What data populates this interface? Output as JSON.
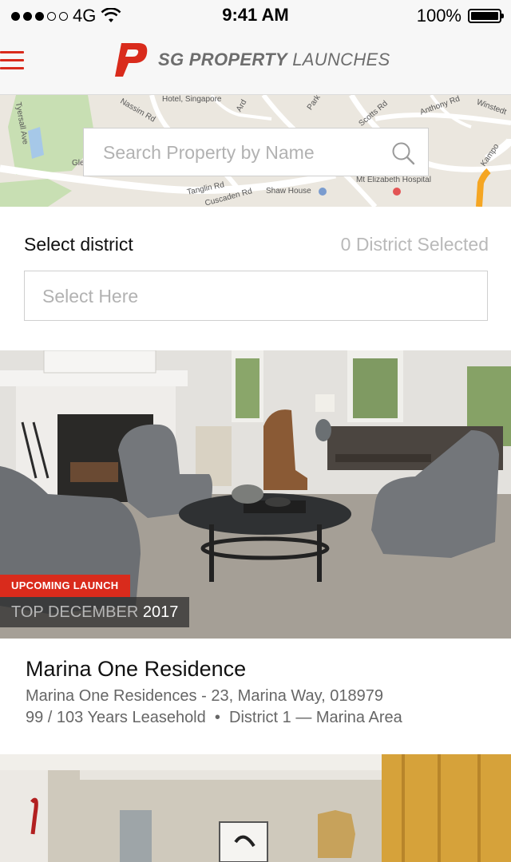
{
  "status_bar": {
    "carrier": "4G",
    "time": "9:41 AM",
    "battery": "100%"
  },
  "header": {
    "logo_bold": "SG PROPERTY",
    "logo_light": "LAUNCHES"
  },
  "map": {
    "labels": [
      "Hotel, Singapore",
      "Nassim Rd",
      "Tyersall Ave",
      "Gle",
      "Tanglin Rd",
      "Cuscaden Rd",
      "Shaw House",
      "Mt Elizabeth Hospital",
      "Scotts Rd",
      "Anthony Rd",
      "Winstedt",
      "Kampo",
      "Ard",
      "Park"
    ]
  },
  "search": {
    "placeholder": "Search Property by Name"
  },
  "district": {
    "label": "Select district",
    "count": "0 District Selected",
    "placeholder": "Select Here"
  },
  "listings": [
    {
      "badge": "UPCOMING LAUNCH",
      "top_label": "TOP DECEMBER",
      "top_year": "2017",
      "title": "Marina One Residence",
      "address": "Marina One Residences - 23, Marina Way, 018979",
      "tenure": "99 / 103 Years Leasehold",
      "district": "District 1 — Marina Area"
    }
  ],
  "colors": {
    "accent": "#d92b1c",
    "text_muted": "#666666",
    "placeholder": "#b2b2b2"
  }
}
